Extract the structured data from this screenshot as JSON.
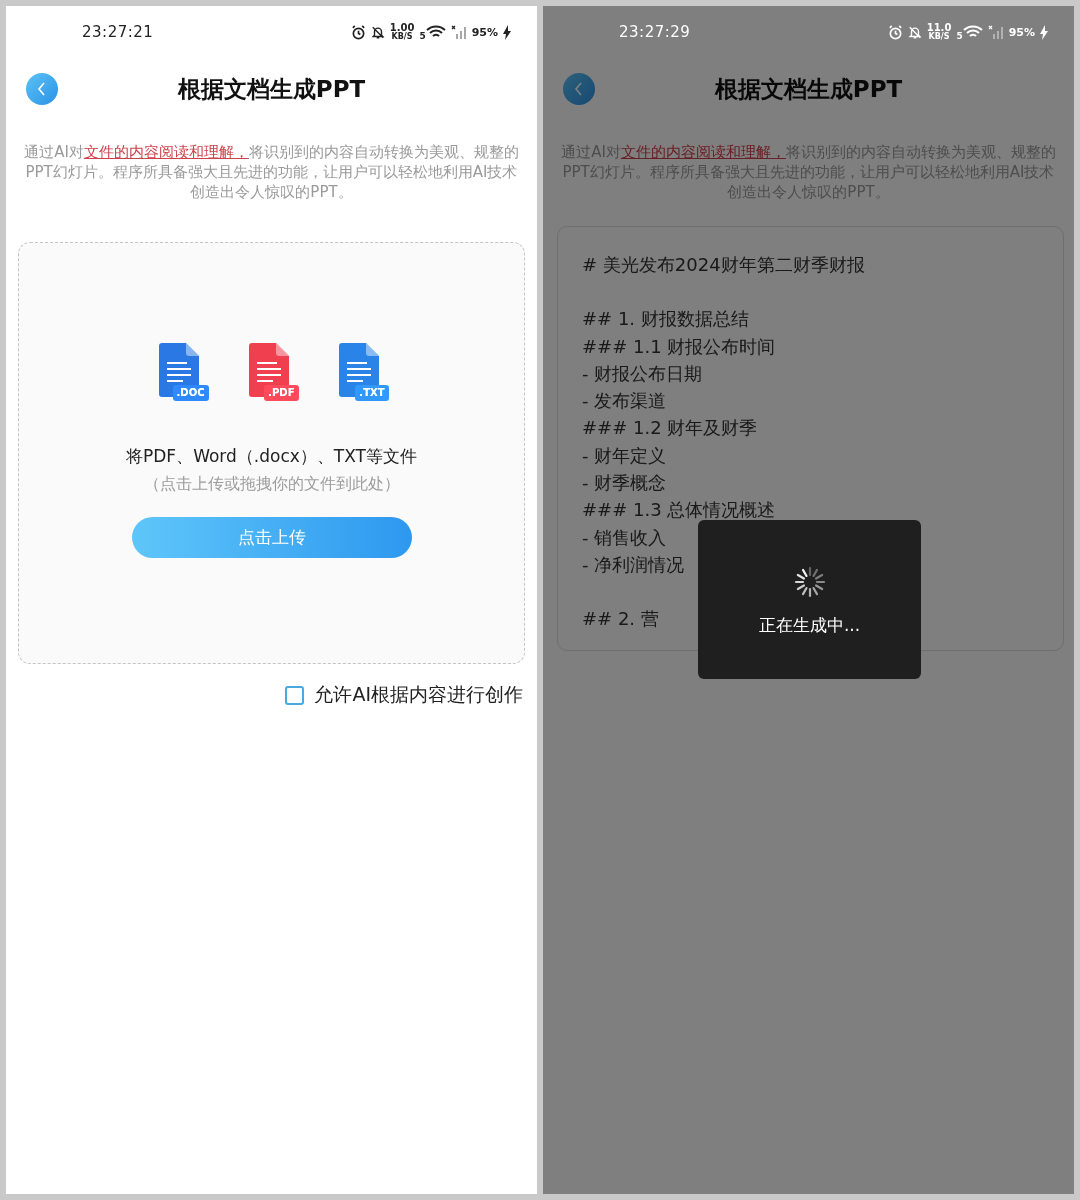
{
  "screens": [
    {
      "kind": "upload",
      "status_bar": {
        "time": "23:27:21",
        "speed": "1.00",
        "speed_unit": "KB/S",
        "network_type": "5",
        "battery": "95%"
      },
      "title": "根据文档生成PPT",
      "description": {
        "before": "通过AI对",
        "link": "文件的内容阅读和理解，",
        "after": "将识别到的内容自动转换为美观、规整的PPT幻灯片。程序所具备强大且先进的功能，让用户可以轻松地利用AI技术创造出令人惊叹的PPT。"
      },
      "upload": {
        "file_types": [
          {
            "label": ".DOC",
            "color": "#2a78e4"
          },
          {
            "label": ".PDF",
            "color": "#f0404f"
          },
          {
            "label": ".TXT",
            "color": "#2a84e8"
          }
        ],
        "prompt": "将PDF、Word（.docx）、TXT等文件",
        "hint": "（点击上传或拖拽你的文件到此处）",
        "button": "点击上传"
      },
      "checkbox": {
        "label": "允许AI根据内容进行创作",
        "checked": false
      }
    },
    {
      "kind": "generating",
      "status_bar": {
        "time": "23:27:29",
        "speed": "11.0",
        "speed_unit": "KB/S",
        "network_type": "5",
        "battery": "95%"
      },
      "title": "根据文档生成PPT",
      "description": {
        "before": "通过AI对",
        "link": "文件的内容阅读和理解，",
        "after": "将识别到的内容自动转换为美观、规整的PPT幻灯片。程序所具备强大且先进的功能，让用户可以轻松地利用AI技术创造出令人惊叹的PPT。"
      },
      "editor": {
        "blocks": [
          {
            "lines": [
              "# 美光发布2024财年第二财季财报"
            ]
          },
          {
            "lines": [
              "## 1. 财报数据总结",
              "### 1.1 财报公布时间",
              "- 财报公布日期",
              "- 发布渠道",
              "### 1.2 财年及财季",
              "- 财年定义",
              "- 财季概念",
              "### 1.3 总体情况概述",
              "- 销售收入",
              "- 净利润情况"
            ]
          },
          {
            "lines": [
              "## 2. 营"
            ]
          }
        ]
      },
      "toast": {
        "text": "正在生成中..."
      }
    }
  ]
}
